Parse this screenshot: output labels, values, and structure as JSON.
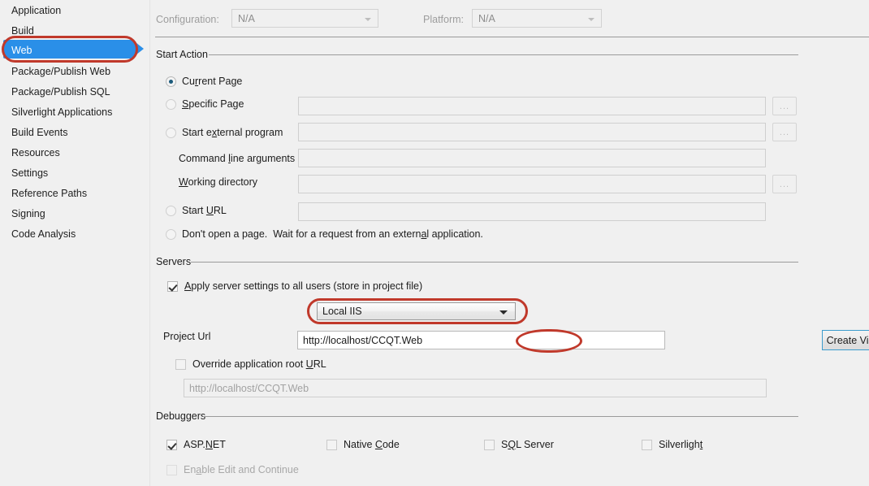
{
  "sidebar": {
    "items": [
      {
        "label": "Application",
        "selected": false
      },
      {
        "label": "Build",
        "selected": false
      },
      {
        "label": "Web",
        "selected": true
      },
      {
        "label": "Package/Publish Web",
        "selected": false
      },
      {
        "label": "Package/Publish SQL",
        "selected": false
      },
      {
        "label": "Silverlight Applications",
        "selected": false
      },
      {
        "label": "Build Events",
        "selected": false
      },
      {
        "label": "Resources",
        "selected": false
      },
      {
        "label": "Settings",
        "selected": false
      },
      {
        "label": "Reference Paths",
        "selected": false
      },
      {
        "label": "Signing",
        "selected": false
      },
      {
        "label": "Code Analysis",
        "selected": false
      }
    ]
  },
  "header": {
    "configuration_label": "Configuration:",
    "configuration_value": "N/A",
    "platform_label": "Platform:",
    "platform_value": "N/A"
  },
  "start_action": {
    "title": "Start Action",
    "current_page": "Current Page",
    "specific_page": "Specific Page",
    "start_external_program": "Start external program",
    "command_line_arguments": "Command line arguments",
    "working_directory": "Working directory",
    "start_url": "Start URL",
    "dont_open_page": "Don't open a page.  Wait for a request from an external application.",
    "browse_label": "...",
    "specific_page_value": "",
    "external_program_value": "",
    "command_args_value": "",
    "working_dir_value": "",
    "start_url_value": "",
    "selected": "current_page"
  },
  "servers": {
    "title": "Servers",
    "apply_settings_label": "Apply server settings to all users (store in project file)",
    "apply_settings_checked": true,
    "server_type": "Local IIS",
    "project_url_label": "Project Url",
    "project_url_value": "http://localhost/CCQT.Web",
    "project_url_prefix": "http://localhost",
    "project_url_suffix": "/CCQT.Web",
    "create_virtual_directory": "Create Virtual Directory",
    "override_root_url_label": "Override application root URL",
    "override_root_url_checked": false,
    "override_root_url_value": "http://localhost/CCQT.Web"
  },
  "debuggers": {
    "title": "Debuggers",
    "items": [
      {
        "label": "ASP.NET",
        "checked": true,
        "disabled": false
      },
      {
        "label": "Native Code",
        "checked": false,
        "disabled": false
      },
      {
        "label": "SQL Server",
        "checked": false,
        "disabled": false
      },
      {
        "label": "Silverlight",
        "checked": false,
        "disabled": false
      }
    ],
    "enable_edit_continue": "Enable Edit and Continue",
    "enable_edit_continue_checked": false,
    "enable_edit_continue_disabled": true
  },
  "annotations": {
    "accent_color": "#c0392b",
    "selection_color": "#2a8fe8"
  }
}
